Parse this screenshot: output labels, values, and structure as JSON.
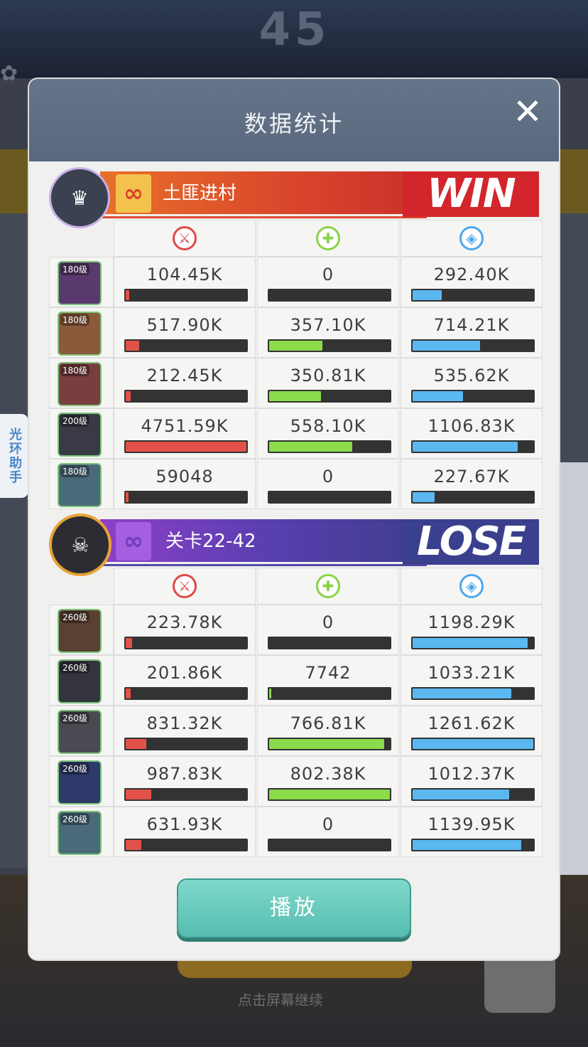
{
  "background": {
    "title": "45",
    "bottom_text": "点击屏幕继续"
  },
  "side_tab": {
    "label": "光环助手"
  },
  "dialog": {
    "title": "数据统计",
    "close_icon": "close-icon",
    "play_label": "播放"
  },
  "colors": {
    "damage": "#e25248",
    "heal": "#8bdb4a",
    "defense": "#5ab7f0",
    "win_badge": "#d2262c",
    "lose_badge": "#3a3f8e",
    "play_button": "#6ccbbe"
  },
  "team_win": {
    "name": "土匪进村",
    "result": "WIN",
    "avatar_icon": "team-avatar-icon",
    "emblem_icon": "guild-emblem-icon",
    "heroes": [
      {
        "level": "180级",
        "frame": "#7cc37a",
        "damage": "104.45K",
        "damage_fill": 0.03,
        "heal": "0",
        "heal_fill": 0.0,
        "defense": "292.40K",
        "defense_fill": 0.24,
        "portrait_color": "#5a3a6e"
      },
      {
        "level": "180级",
        "frame": "#7cc37a",
        "damage": "517.90K",
        "damage_fill": 0.11,
        "heal": "357.10K",
        "heal_fill": 0.44,
        "defense": "714.21K",
        "defense_fill": 0.56,
        "portrait_color": "#8a5a3a"
      },
      {
        "level": "180级",
        "frame": "#7cc37a",
        "damage": "212.45K",
        "damage_fill": 0.04,
        "heal": "350.81K",
        "heal_fill": 0.43,
        "defense": "535.62K",
        "defense_fill": 0.42,
        "portrait_color": "#7a3e3e"
      },
      {
        "level": "200级",
        "frame": "#7cc37a",
        "damage": "4751.59K",
        "damage_fill": 1.0,
        "heal": "558.10K",
        "heal_fill": 0.69,
        "defense": "1106.83K",
        "defense_fill": 0.87,
        "portrait_color": "#3a3a46"
      },
      {
        "level": "180级",
        "frame": "#7cc37a",
        "damage": "59048",
        "damage_fill": 0.01,
        "heal": "0",
        "heal_fill": 0.0,
        "defense": "227.67K",
        "defense_fill": 0.18,
        "portrait_color": "#4a6a7a"
      }
    ]
  },
  "team_lose": {
    "name": "关卡22-42",
    "result": "LOSE",
    "avatar_icon": "boss-avatar-icon",
    "emblem_icon": "stage-emblem-icon",
    "heroes": [
      {
        "level": "260级",
        "frame": "#7cc37a",
        "damage": "223.78K",
        "damage_fill": 0.05,
        "heal": "0",
        "heal_fill": 0.0,
        "defense": "1198.29K",
        "defense_fill": 0.95,
        "portrait_color": "#5a4032"
      },
      {
        "level": "260级",
        "frame": "#7cc37a",
        "damage": "201.86K",
        "damage_fill": 0.04,
        "heal": "7742",
        "heal_fill": 0.01,
        "defense": "1033.21K",
        "defense_fill": 0.82,
        "portrait_color": "#34343e"
      },
      {
        "level": "260级",
        "frame": "#7cc37a",
        "damage": "831.32K",
        "damage_fill": 0.17,
        "heal": "766.81K",
        "heal_fill": 0.95,
        "defense": "1261.62K",
        "defense_fill": 1.0,
        "portrait_color": "#4a4a52"
      },
      {
        "level": "260级",
        "frame": "#7cc37a",
        "damage": "987.83K",
        "damage_fill": 0.21,
        "heal": "802.38K",
        "heal_fill": 1.0,
        "defense": "1012.37K",
        "defense_fill": 0.8,
        "portrait_color": "#2e3a6a"
      },
      {
        "level": "260级",
        "frame": "#7cc37a",
        "damage": "631.93K",
        "damage_fill": 0.13,
        "heal": "0",
        "heal_fill": 0.0,
        "defense": "1139.95K",
        "defense_fill": 0.9,
        "portrait_color": "#4a6a7a"
      }
    ]
  },
  "stat_icons": {
    "damage": "damage-icon",
    "heal": "heal-icon",
    "defense": "defense-shield-icon"
  }
}
